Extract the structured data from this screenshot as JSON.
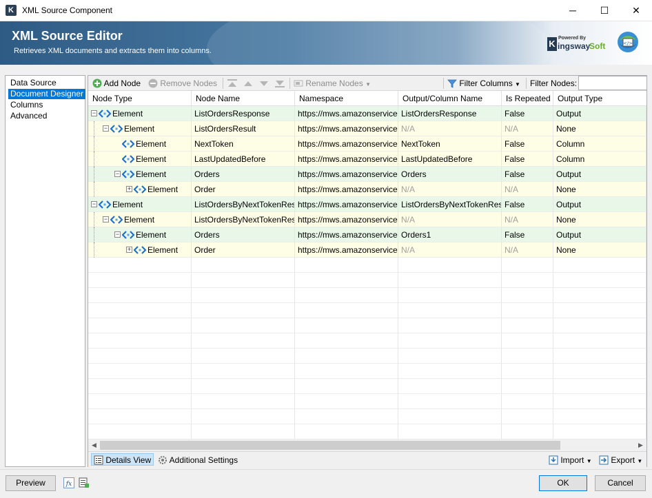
{
  "window": {
    "title": "XML Source Component",
    "app_icon": "K",
    "controls": {
      "minimize": "─",
      "maximize": "☐",
      "close": "✕"
    }
  },
  "banner": {
    "title": "XML Source Editor",
    "subtitle": "Retrieves XML documents and extracts them into columns.",
    "brand_powered": "Powered By",
    "brand_k": "K",
    "brand_name1": "ingsway",
    "brand_name2": "Soft"
  },
  "nav": {
    "items": [
      {
        "label": "Data Source",
        "selected": false
      },
      {
        "label": "Document Designer",
        "selected": true
      },
      {
        "label": "Columns",
        "selected": false
      },
      {
        "label": "Advanced",
        "selected": false
      }
    ]
  },
  "toolbar": {
    "add_node": "Add Node",
    "remove_nodes": "Remove Nodes",
    "rename_nodes": "Rename Nodes",
    "filter_columns": "Filter Columns",
    "filter_nodes": "Filter Nodes:",
    "filter_nodes_value": ""
  },
  "grid": {
    "headers": [
      "Node Type",
      "Node Name",
      "Namespace",
      "Output/Column Name",
      "Is Repeated",
      "Output Type"
    ],
    "rows": [
      {
        "type": "Element",
        "name": "ListOrdersResponse",
        "ns": "https://mws.amazonservice...",
        "output": "ListOrdersResponse",
        "repeated": "False",
        "otype": "Output",
        "level": 0,
        "expander": "−",
        "color": "green"
      },
      {
        "type": "Element",
        "name": "ListOrdersResult",
        "ns": "https://mws.amazonservice...",
        "output": "N/A",
        "repeated": "N/A",
        "otype": "None",
        "level": 1,
        "expander": "−",
        "color": "yellow"
      },
      {
        "type": "Element",
        "name": "NextToken",
        "ns": "https://mws.amazonservice...",
        "output": "NextToken",
        "repeated": "False",
        "otype": "Column",
        "level": 2,
        "expander": "",
        "color": "yellow"
      },
      {
        "type": "Element",
        "name": "LastUpdatedBefore",
        "ns": "https://mws.amazonservice...",
        "output": "LastUpdatedBefore",
        "repeated": "False",
        "otype": "Column",
        "level": 2,
        "expander": "",
        "color": "yellow"
      },
      {
        "type": "Element",
        "name": "Orders",
        "ns": "https://mws.amazonservice...",
        "output": "Orders",
        "repeated": "False",
        "otype": "Output",
        "level": 2,
        "expander": "−",
        "color": "green"
      },
      {
        "type": "Element",
        "name": "Order",
        "ns": "https://mws.amazonservice...",
        "output": "N/A",
        "repeated": "N/A",
        "otype": "None",
        "level": 3,
        "expander": "+",
        "color": "yellow"
      },
      {
        "type": "Element",
        "name": "ListOrdersByNextTokenRes...",
        "ns": "https://mws.amazonservice...",
        "output": "ListOrdersByNextTokenRes...",
        "repeated": "False",
        "otype": "Output",
        "level": 0,
        "expander": "−",
        "color": "green"
      },
      {
        "type": "Element",
        "name": "ListOrdersByNextTokenResult",
        "ns": "https://mws.amazonservice...",
        "output": "N/A",
        "repeated": "N/A",
        "otype": "None",
        "level": 1,
        "expander": "−",
        "color": "yellow"
      },
      {
        "type": "Element",
        "name": "Orders",
        "ns": "https://mws.amazonservice...",
        "output": "Orders1",
        "repeated": "False",
        "otype": "Output",
        "level": 2,
        "expander": "−",
        "color": "green"
      },
      {
        "type": "Element",
        "name": "Order",
        "ns": "https://mws.amazonservice...",
        "output": "N/A",
        "repeated": "N/A",
        "otype": "None",
        "level": 3,
        "expander": "+",
        "color": "yellow"
      }
    ]
  },
  "bottom": {
    "details_view": "Details View",
    "additional_settings": "Additional Settings",
    "import": "Import",
    "export": "Export"
  },
  "footer": {
    "preview": "Preview",
    "ok": "OK",
    "cancel": "Cancel"
  },
  "colors": {
    "selection": "#0078d7",
    "row_green": "#e8f7e8",
    "row_yellow": "#fefee6",
    "element_icon": "#1f6fd1"
  }
}
